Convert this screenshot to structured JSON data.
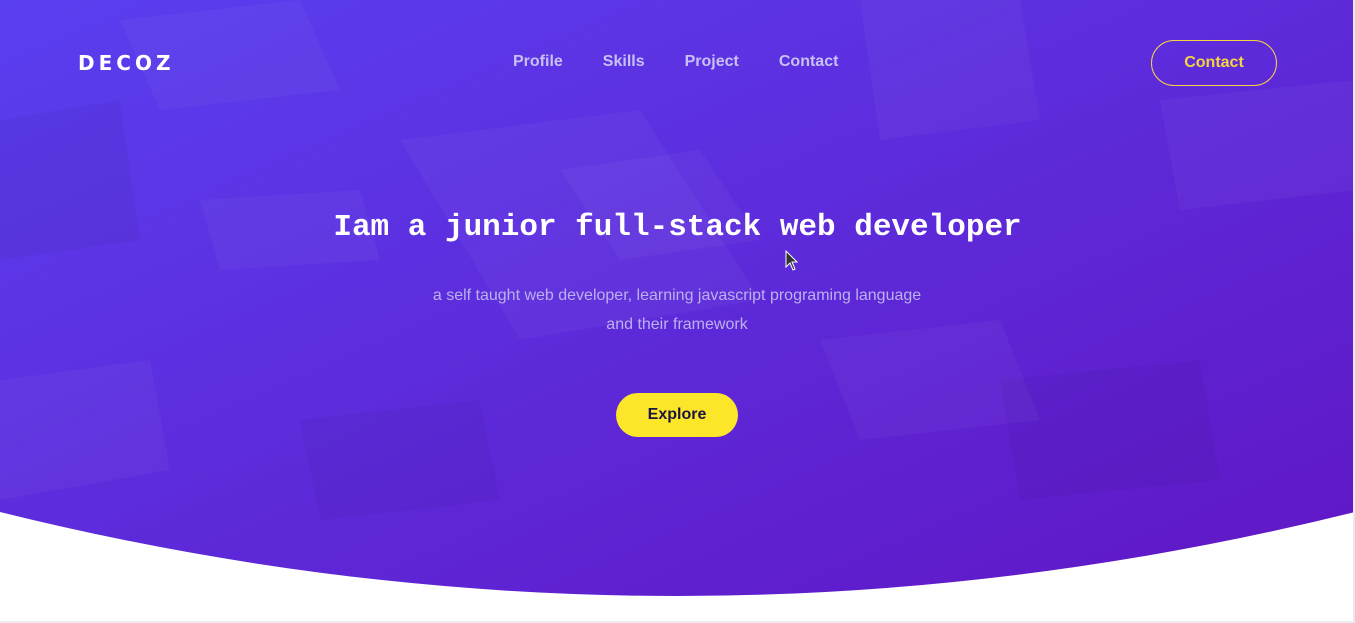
{
  "colors": {
    "gradient_start": "#5a3ff0",
    "gradient_end": "#6016c4",
    "accent_yellow": "#fce62a",
    "contact_outline": "#f5d442",
    "nav_link": "#c9c0f4",
    "subtitle": "#bdb1ee"
  },
  "header": {
    "logo": "DECOZ",
    "nav": [
      {
        "label": "Profile"
      },
      {
        "label": "Skills"
      },
      {
        "label": "Project"
      },
      {
        "label": "Contact"
      }
    ],
    "contact_button": "Contact"
  },
  "hero": {
    "headline": "Iam a junior full-stack web developer",
    "subtitle": "a self taught web developer, learning javascript programing language and their framework",
    "cta": "Explore"
  },
  "icons": {
    "cursor": "mouse-pointer-icon"
  }
}
